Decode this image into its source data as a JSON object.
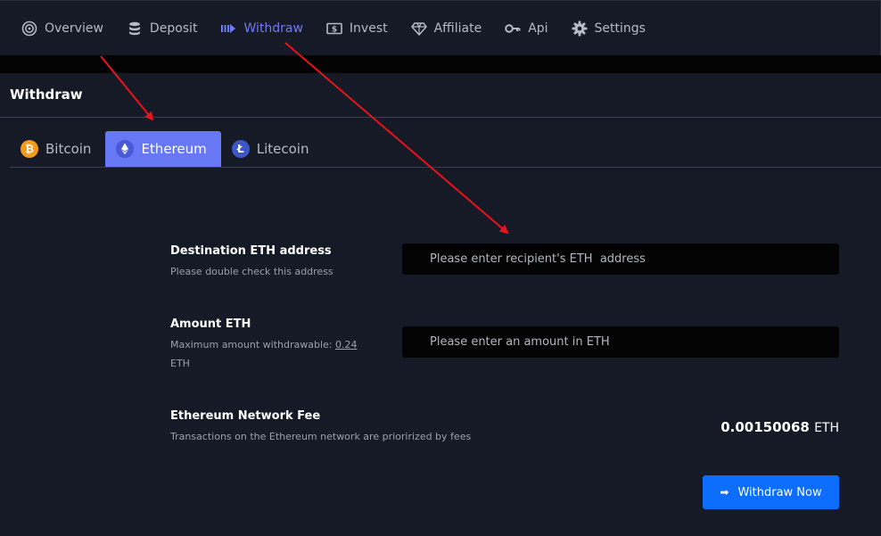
{
  "nav": {
    "items": [
      {
        "label": "Overview",
        "icon": "target-icon"
      },
      {
        "label": "Deposit",
        "icon": "database-icon"
      },
      {
        "label": "Withdraw",
        "icon": "withdraw-arrow-icon",
        "active": true
      },
      {
        "label": "Invest",
        "icon": "dollar-bill-icon"
      },
      {
        "label": "Affiliate",
        "icon": "diamond-icon"
      },
      {
        "label": "Api",
        "icon": "key-icon"
      },
      {
        "label": "Settings",
        "icon": "gear-icon"
      }
    ]
  },
  "panel": {
    "title": "Withdraw"
  },
  "tabs": [
    {
      "label": "Bitcoin",
      "icon": "bitcoin-icon"
    },
    {
      "label": "Ethereum",
      "icon": "ethereum-icon",
      "active": true
    },
    {
      "label": "Litecoin",
      "icon": "litecoin-icon"
    }
  ],
  "form": {
    "address": {
      "label": "Destination ETH address",
      "help": "Please double check this address",
      "placeholder": "Please enter recipient's ETH  address",
      "value": ""
    },
    "amount": {
      "label": "Amount ETH",
      "help_prefix": "Maximum amount withdrawable: ",
      "max": "0.24",
      "help_suffix": "ETH",
      "placeholder": "Please enter an amount in ETH",
      "value": ""
    },
    "fee": {
      "label": "Ethereum Network Fee",
      "help": "Transactions on the Ethereum network are priorirized by fees",
      "value": "0.00150068",
      "unit": "ETH"
    },
    "submit_label": "Withdraw Now"
  },
  "colors": {
    "accent": "#6878f5",
    "button": "#0d6efd",
    "annotation_arrow": "#e8141b"
  }
}
